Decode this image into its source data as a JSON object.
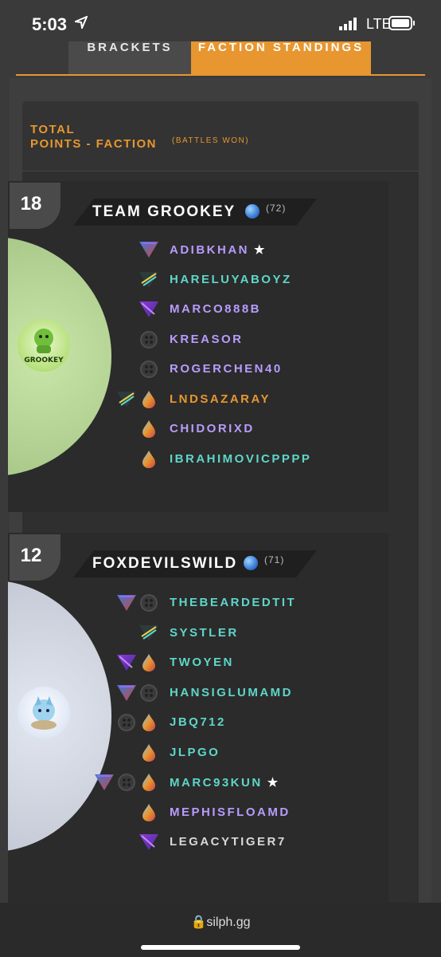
{
  "status": {
    "time": "5:03",
    "network": "LTE"
  },
  "tabs": [
    {
      "label": "BRACKETS"
    },
    {
      "label": "FACTION STANDINGS"
    }
  ],
  "header": {
    "title_line1": "TOTAL",
    "title_line2": "POINTS - FACTION",
    "subtitle": "(BATTLES WON)"
  },
  "teams": [
    {
      "rank": "18",
      "name": "TEAM GROOKEY",
      "points": "(72)",
      "logo_text": "GROOKEY",
      "colors": {
        "art": "#bfe3a0"
      },
      "players": [
        {
          "name": "ADIBKHAN",
          "star": "★",
          "icons": [
            "mystic-icon"
          ],
          "color": "#b89cff"
        },
        {
          "name": "HARELUYABOYZ",
          "star": "",
          "icons": [
            "instinct-icon"
          ],
          "color": "#5ed6c9"
        },
        {
          "name": "MARCO888B",
          "star": "",
          "icons": [
            "valor-purple-icon"
          ],
          "color": "#b89cff"
        },
        {
          "name": "KREASOR",
          "star": "",
          "icons": [
            "hex-icon"
          ],
          "color": "#b89cff"
        },
        {
          "name": "ROGERCHEN40",
          "star": "",
          "icons": [
            "hex-icon"
          ],
          "color": "#b89cff"
        },
        {
          "name": "LNDSAZARAY",
          "star": "",
          "icons": [
            "instinct-icon",
            "drop-icon"
          ],
          "color": "#e8962f"
        },
        {
          "name": "CHIDORIXD",
          "star": "",
          "icons": [
            "drop-icon"
          ],
          "color": "#b89cff"
        },
        {
          "name": "IBRAHIMOVICPPPP",
          "star": "",
          "icons": [
            "drop-icon"
          ],
          "color": "#5ed6c9"
        }
      ]
    },
    {
      "rank": "12",
      "name": "FOXDEVILSWILD",
      "points": "(71)",
      "logo_text": "",
      "colors": {
        "art": "#d8dde8"
      },
      "players": [
        {
          "name": "THEBEARDEDTIT",
          "star": "",
          "icons": [
            "mystic-icon",
            "hex-icon"
          ],
          "color": "#5ed6c9"
        },
        {
          "name": "SYSTLER",
          "star": "",
          "icons": [
            "instinct-icon"
          ],
          "color": "#5ed6c9"
        },
        {
          "name": "TWOYEN",
          "star": "",
          "icons": [
            "valor-purple-icon",
            "drop-icon"
          ],
          "color": "#5ed6c9"
        },
        {
          "name": "HANSIGLUMAMD",
          "star": "",
          "icons": [
            "mystic-icon",
            "hex-icon"
          ],
          "color": "#5ed6c9"
        },
        {
          "name": "JBQ712",
          "star": "",
          "icons": [
            "hex-icon",
            "drop-icon"
          ],
          "color": "#5ed6c9"
        },
        {
          "name": "JLPGO",
          "star": "",
          "icons": [
            "drop-icon"
          ],
          "color": "#5ed6c9"
        },
        {
          "name": "MARC93KUN",
          "star": "★",
          "icons": [
            "mystic-icon",
            "hex-icon",
            "drop-icon"
          ],
          "color": "#5ed6c9"
        },
        {
          "name": "MEPHISFLOAMD",
          "star": "",
          "icons": [
            "drop-icon"
          ],
          "color": "#b89cff"
        },
        {
          "name": "LEGACYTIGER7",
          "star": "",
          "icons": [
            "valor-purple-icon"
          ],
          "color": "#d8d8d8"
        }
      ]
    }
  ],
  "browser": {
    "url": "silph.gg"
  }
}
